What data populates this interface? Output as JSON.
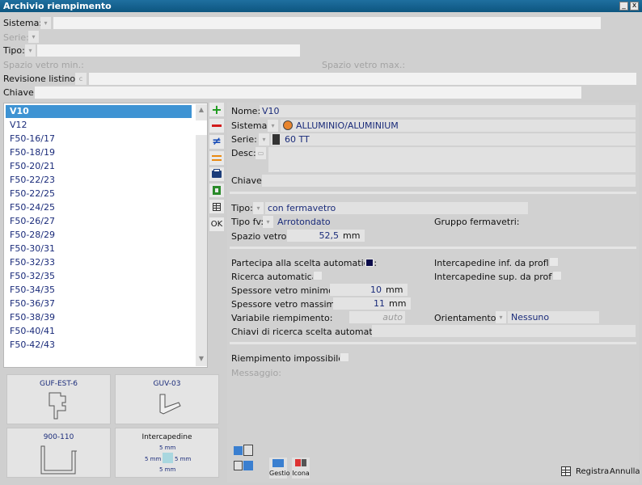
{
  "window": {
    "title": "Archivio riempimento",
    "btn_min": "_",
    "btn_close": "x"
  },
  "filters": {
    "sistema_label": "Sistema:",
    "serie_label": "Serie:",
    "tipo_label": "Tipo:",
    "spazio_min_label": "Spazio vetro min.:",
    "spazio_max_label": "Spazio vetro max.:",
    "revisione_label": "Revisione listino:",
    "revisione_btn": "c",
    "chiave_label": "Chiave:"
  },
  "list": {
    "items": [
      "V10",
      "V12",
      "F50-16/17",
      "F50-18/19",
      "F50-20/21",
      "F50-22/23",
      "F50-22/25",
      "F50-24/25",
      "F50-26/27",
      "F50-28/29",
      "F50-30/31",
      "F50-32/33",
      "F50-32/35",
      "F50-34/35",
      "F50-36/37",
      "F50-38/39",
      "F50-40/41",
      "F50-42/43"
    ],
    "selected_index": 0,
    "count": "17"
  },
  "toolbar": {
    "ok_label": "OK"
  },
  "thumbnails": {
    "t1": "GUF-EST-6",
    "t2": "GUV-03",
    "t3": "900-110",
    "t4": "Intercapedine",
    "dim_top": "5 mm",
    "dim_left": "5 mm",
    "dim_right": "5 mm",
    "dim_bottom": "5 mm"
  },
  "detail": {
    "nome_label": "Nome:",
    "nome_value": "V10",
    "sistema_label": "Sistema:",
    "sistema_value": "ALLUMINIO/ALUMINIUM",
    "serie_label": "Serie:",
    "serie_value": "60 TT",
    "desc_label": "Desc:",
    "chiave_label": "Chiave:",
    "tipo_label": "Tipo:",
    "tipo_value": "con fermavetro",
    "tipofv_label": "Tipo fv:",
    "tipofv_value": "Arrotondato",
    "gruppo_label": "Gruppo fermavetri:",
    "spazio_label": "Spazio vetro:",
    "spazio_value": "52,5",
    "spazio_unit": "mm",
    "partecipa_label": "Partecipa alla scelta automatica:",
    "ricerca_label": "Ricerca automatica:",
    "interc_inf_label": "Intercapedine inf. da proflo:",
    "interc_sup_label": "Intercapedine sup. da proflo:",
    "spess_min_label": "Spessore vetro minimo:",
    "spess_min_value": "10",
    "spess_min_unit": "mm",
    "spess_max_label": "Spessore vetro massimo:",
    "spess_max_value": "11",
    "spess_max_unit": "mm",
    "variabile_label": "Variabile riempimento:",
    "variabile_value": "auto",
    "orient_label": "Orientamento:",
    "orient_value": "Nessuno",
    "chiavi_label": "Chiavi di ricerca scelta automatica:",
    "impossibile_label": "Riempimento impossibile:",
    "messaggio_label": "Messaggio:"
  },
  "footer": {
    "gestio_label": "Gestio",
    "icona_label": "Icona",
    "registra_label": "Registra",
    "annulla_label": "Annulla"
  },
  "colors": {
    "accent": "#3e93d3",
    "title_bar": "#0d5680",
    "text_value": "#1a2b7a"
  }
}
